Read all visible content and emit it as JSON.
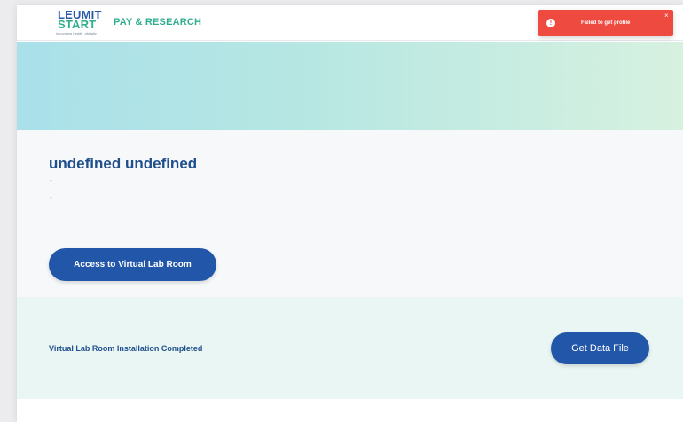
{
  "header": {
    "logo": {
      "line1": "LEUMIT",
      "line2": "START",
      "tagline": "innovating health, digitally"
    },
    "brand_title": "PAY & RESEARCH"
  },
  "toast": {
    "icon": "alert-circle-icon",
    "icon_glyph": "!",
    "message": "Failed to get profile",
    "close_glyph": "×",
    "color": "#ee4a3f"
  },
  "profile": {
    "name": "undefined undefined",
    "detail_1": "-",
    "detail_2": "-",
    "access_button_label": "Access to Virtual Lab Room"
  },
  "installation": {
    "status_text": "Virtual Lab Room Installation Completed",
    "data_button_label": "Get Data File"
  },
  "colors": {
    "primary": "#2256a8",
    "accent_green": "#2fae8e",
    "heading": "#1f4f8c",
    "error": "#ee4a3f"
  }
}
